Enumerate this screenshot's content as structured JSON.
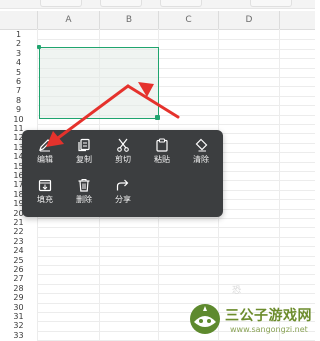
{
  "columns": [
    "A",
    "B",
    "C",
    "D"
  ],
  "rows": [
    "1",
    "2",
    "3",
    "4",
    "5",
    "6",
    "7",
    "8",
    "9",
    "10",
    "11",
    "12",
    "13",
    "14",
    "15",
    "16",
    "17",
    "18",
    "19",
    "20",
    "21",
    "22",
    "23",
    "24",
    "25",
    "26",
    "27",
    "28",
    "29",
    "30",
    "31",
    "32",
    "33"
  ],
  "context_menu": {
    "row1": [
      {
        "id": "edit",
        "label": "编辑",
        "icon": "pencil-icon"
      },
      {
        "id": "copy",
        "label": "复制",
        "icon": "copy-icon"
      },
      {
        "id": "cut",
        "label": "剪切",
        "icon": "scissors-icon"
      },
      {
        "id": "paste",
        "label": "粘贴",
        "icon": "clipboard-icon"
      },
      {
        "id": "clear",
        "label": "清除",
        "icon": "eraser-icon"
      }
    ],
    "row2": [
      {
        "id": "fill",
        "label": "填充",
        "icon": "fill-icon"
      },
      {
        "id": "delete",
        "label": "删除",
        "icon": "trash-icon"
      },
      {
        "id": "share",
        "label": "分享",
        "icon": "share-icon"
      }
    ]
  },
  "colors": {
    "selection": "#1fa46e",
    "menu_bg": "#3c3e40",
    "arrow": "#e5322c"
  },
  "watermark": {
    "title": "三公子游戏网",
    "url": "www.sangongzi.net",
    "faint": "恐"
  }
}
